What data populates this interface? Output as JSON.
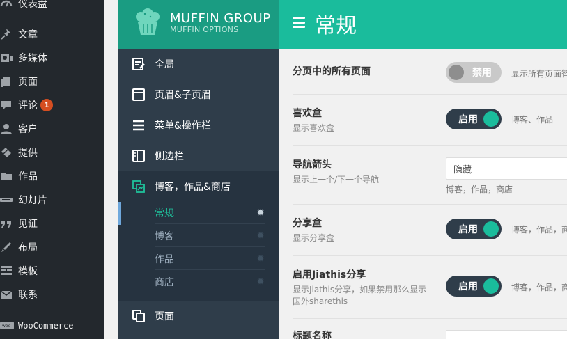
{
  "wp_menu": {
    "items": [
      {
        "label": "仪表盘",
        "icon": "dashboard-icon"
      },
      {
        "label": "文章",
        "icon": "pin-icon"
      },
      {
        "label": "多媒体",
        "icon": "media-icon"
      },
      {
        "label": "页面",
        "icon": "page-icon"
      },
      {
        "label": "评论",
        "icon": "comment-icon",
        "badge": "1"
      },
      {
        "label": "客户",
        "icon": "user-icon"
      },
      {
        "label": "提供",
        "icon": "tag-icon"
      },
      {
        "label": "作品",
        "icon": "folder-icon"
      },
      {
        "label": "幻灯片",
        "icon": "slider-icon"
      },
      {
        "label": "见证",
        "icon": "quote-icon"
      },
      {
        "label": "布局",
        "icon": "brush-icon"
      },
      {
        "label": "模板",
        "icon": "template-icon"
      },
      {
        "label": "联系",
        "icon": "mail-icon"
      },
      {
        "label": "WooCommerce",
        "icon": "woo-icon"
      }
    ]
  },
  "muffin": {
    "brand": "MUFFIN GROUP",
    "brand_sub": "MUFFIN OPTIONS",
    "nav": [
      {
        "label": "全局",
        "icon": "edit-icon"
      },
      {
        "label": "页眉&子页眉",
        "icon": "window-icon"
      },
      {
        "label": "菜单&操作栏",
        "icon": "menu-icon"
      },
      {
        "label": "侧边栏",
        "icon": "sidebar-icon"
      },
      {
        "label": "博客，作品&商店",
        "icon": "blog-icon"
      },
      {
        "label": "页面",
        "icon": "pages-icon"
      }
    ],
    "sub": [
      {
        "label": "常规"
      },
      {
        "label": "博客"
      },
      {
        "label": "作品"
      },
      {
        "label": "商店"
      }
    ]
  },
  "main": {
    "title": "常规",
    "rows": [
      {
        "label": "分页中的所有页面",
        "desc": "",
        "control": "禁用",
        "help": "显示所有页面智"
      },
      {
        "label": "喜欢盒",
        "desc": "显示喜欢盒",
        "control": "启用",
        "help": "博客、作品"
      },
      {
        "label": "导航箭头",
        "desc": "显示上一个/下一个导航",
        "control": "隐藏",
        "help": "博客，作品，商店"
      },
      {
        "label": "分享盒",
        "desc": "显示分享盒",
        "control": "启用",
        "help": "博客，作品，商"
      },
      {
        "label": "启用Jiathis分享",
        "desc": "显示Jiathis分享，如果禁用那么显示国外sharethis",
        "control": "启用",
        "help": "博客，作品，商"
      },
      {
        "label": "标题名称",
        "desc": "",
        "control": "",
        "help": ""
      }
    ]
  },
  "colors": {
    "accent": "#1abc9c",
    "panel": "#2f3d4a",
    "wp_bg": "#23282d",
    "badge": "#d54e21"
  }
}
